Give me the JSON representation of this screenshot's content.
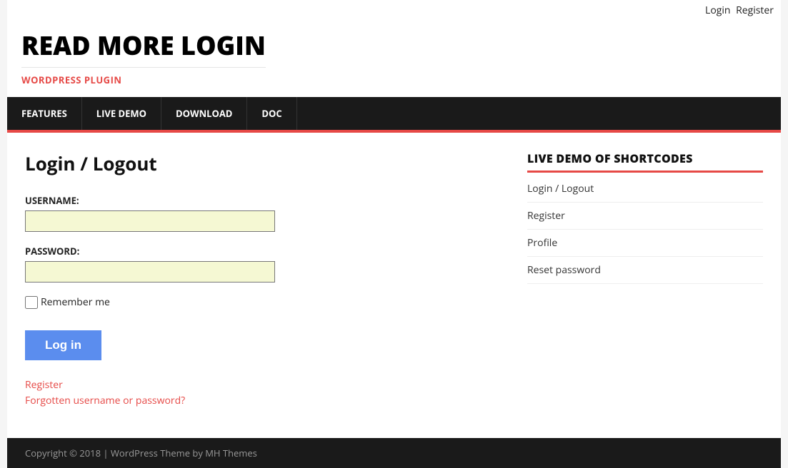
{
  "topbar": {
    "login": "Login",
    "register": "Register"
  },
  "header": {
    "title": "READ MORE LOGIN",
    "tagline": "WORDPRESS PLUGIN"
  },
  "nav": {
    "items": [
      {
        "label": "FEATURES"
      },
      {
        "label": "LIVE DEMO"
      },
      {
        "label": "DOWNLOAD"
      },
      {
        "label": "DOC"
      }
    ]
  },
  "page": {
    "title": "Login / Logout"
  },
  "form": {
    "username_label": "USERNAME:",
    "password_label": "PASSWORD:",
    "remember_label": "Remember me",
    "login_button": "Log in",
    "register_link": "Register",
    "forgot_link": "Forgotten username or password?"
  },
  "sidebar": {
    "widget_title": "LIVE DEMO OF SHORTCODES",
    "items": [
      {
        "label": "Login / Logout"
      },
      {
        "label": "Register"
      },
      {
        "label": "Profile"
      },
      {
        "label": "Reset password"
      }
    ]
  },
  "footer": {
    "text": "Copyright © 2018 | WordPress Theme by MH Themes"
  }
}
